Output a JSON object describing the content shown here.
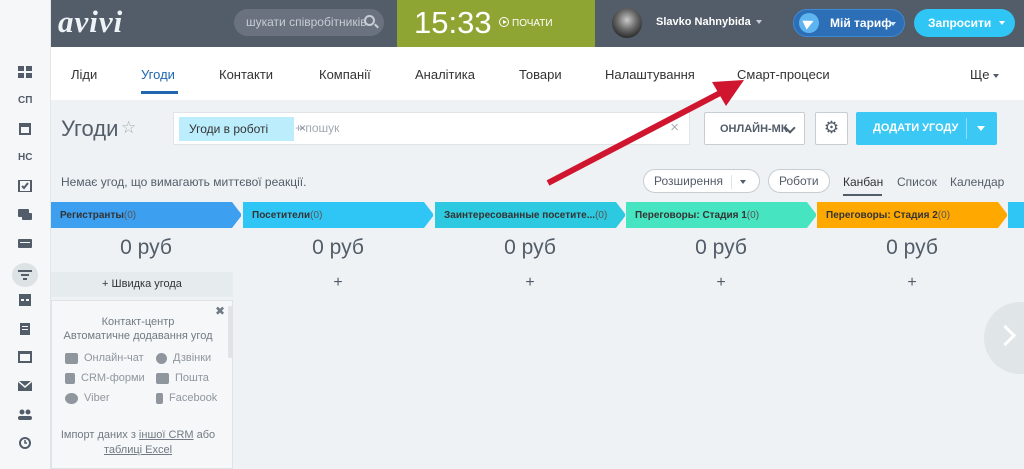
{
  "topbar": {
    "logo": "avivi",
    "search_placeholder": "шукати співробітників",
    "clock_time": "15:33",
    "clock_start": "ПОЧАТИ",
    "user_name": "Slavko Nahnybida",
    "tariff_label": "Мій тариф",
    "invite_label": "Запросити"
  },
  "menu": {
    "items": [
      "Ліди",
      "Угоди",
      "Контакти",
      "Компанії",
      "Аналітика",
      "Товари",
      "Налаштування",
      "Смарт-процеси"
    ],
    "active": "Угоди",
    "more": "Ще"
  },
  "sidebar": {
    "items": [
      "apps-icon",
      "СП",
      "calendar-icon",
      "НС",
      "tasks-icon",
      "chat-icon",
      "drive-icon",
      "crm-funnel-icon",
      "planner-icon",
      "docs-icon",
      "window-icon",
      "mail-icon",
      "group-icon",
      "clock-icon"
    ],
    "label_sp": "СП",
    "label_ns": "НС"
  },
  "page": {
    "title": "Угоди",
    "filter_chip": "Угоди в роботі",
    "filter_placeholder": "+ пошук",
    "pipeline_select": "ОНЛАЙН-МК",
    "add_button": "ДОДАТИ УГОДУ",
    "notice": "Немає угод, що вимагають миттєвої реакції.",
    "extensions_label": "Розширення",
    "robots_label": "Роботи",
    "views": [
      "Канбан",
      "Список",
      "Календар"
    ],
    "active_view": "Канбан"
  },
  "kanban": {
    "columns": [
      {
        "title": "Регистранты",
        "count": "(0)",
        "sum": "0 руб",
        "color": "#3c9ff0"
      },
      {
        "title": "Посетители",
        "count": "(0)",
        "sum": "0 руб",
        "color": "#2fc6f6"
      },
      {
        "title": "Заинтересованные посетите...",
        "count": "(0)",
        "sum": "0 руб",
        "color": "#2dc9e0"
      },
      {
        "title": "Переговоры: Стадия 1",
        "count": "(0)",
        "sum": "0 руб",
        "color": "#47e4c2"
      },
      {
        "title": "Переговоры: Стадия 2",
        "count": "(0)",
        "sum": "0 руб",
        "color": "#ffa900"
      }
    ],
    "quick_deal": "+ Швидка угода",
    "add_plus": "+"
  },
  "contact_center": {
    "title": "Контакт-центр",
    "subtitle": "Автоматичне додавання угод",
    "channels": [
      "Онлайн-чат",
      "Дзвінки",
      "CRM-форми",
      "Пошта",
      "Viber",
      "Facebook"
    ],
    "import_prefix": "Імпорт даних з ",
    "import_link1": "іншої CRM",
    "import_mid": " або",
    "import_link2": "таблиці Excel"
  },
  "colors": {
    "topbar": "#535c69",
    "clock": "#8ea534",
    "accent": "#2fc6f6",
    "annotation_arrow": "#d0152f"
  }
}
